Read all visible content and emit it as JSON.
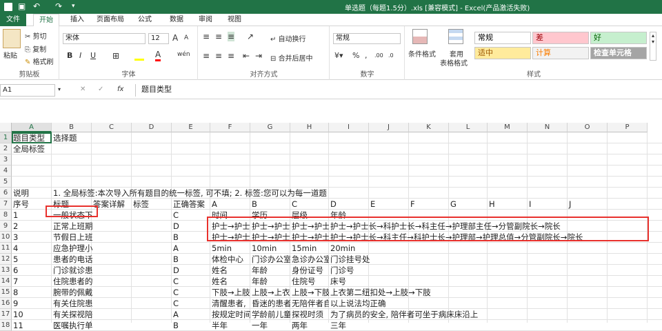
{
  "window": {
    "title": "单选题（每题1.5分）.xls  [兼容模式] - Excel(产品激活失败)"
  },
  "tabs": [
    "文件",
    "开始",
    "插入",
    "页面布局",
    "公式",
    "数据",
    "审阅",
    "视图"
  ],
  "ribbon": {
    "clipboard": {
      "label": "剪贴板",
      "paste": "粘贴",
      "cut": "剪切",
      "copy": "复制",
      "format_painter": "格式刷"
    },
    "font": {
      "label": "字体",
      "name": "宋体",
      "size": "12",
      "bold": "B",
      "italic": "I",
      "underline": "U",
      "grow": "A",
      "shrink": "A",
      "font_color_glyph": "A",
      "wen": "wén"
    },
    "alignment": {
      "label": "对齐方式",
      "wrap": "自动换行",
      "merge": "合并后居中"
    },
    "number": {
      "label": "数字",
      "format": "常规",
      "percent": "%",
      "comma": ","
    },
    "styles_group": {
      "label": "样式",
      "cond_format": "条件格式",
      "table_format_1": "套用",
      "table_format_2": "表格格式",
      "cells": [
        {
          "text": "常规",
          "bg": "#ffffff",
          "fg": "#000000"
        },
        {
          "text": "差",
          "bg": "#ffc7ce",
          "fg": "#9c0006"
        },
        {
          "text": "好",
          "bg": "#c6efce",
          "fg": "#006100"
        },
        {
          "text": "适中",
          "bg": "#ffeb9c",
          "fg": "#9c5700"
        },
        {
          "text": "计算",
          "bg": "#f2f2f2",
          "fg": "#fa7d00"
        },
        {
          "text": "检查单元格",
          "bg": "#a5a5a5",
          "fg": "#ffffff"
        }
      ]
    }
  },
  "formula_bar": {
    "name_box": "A1",
    "fx": "fx",
    "content": "题目类型"
  },
  "columns": [
    "A",
    "B",
    "C",
    "D",
    "E",
    "F",
    "G",
    "H",
    "I",
    "J",
    "K",
    "L",
    "M",
    "N",
    "O",
    "P"
  ],
  "rows": [
    "1",
    "2",
    "3",
    "4",
    "5",
    "6",
    "7",
    "8",
    "9",
    "10",
    "11",
    "12",
    "13",
    "14",
    "15",
    "16",
    "17",
    "18"
  ],
  "cells": {
    "r1": {
      "a": "题目类型",
      "b": "选择题"
    },
    "r2": {
      "a": "全局标签"
    },
    "r6": {
      "a": "说明",
      "b": "1. 全局标签:本次导入所有题目的统一标签, 可不填; 2. 标签:您可以为每一道题"
    },
    "r7": {
      "a": "序号",
      "b": "标题",
      "c": "答案详解",
      "d": "标签",
      "e": "正确答案",
      "f": "A",
      "g": "B",
      "h": "C",
      "i": "D",
      "j": "E",
      "k": "F",
      "l": "G",
      "m": "H",
      "n": "I",
      "o": "J"
    },
    "r8": {
      "a": "1",
      "b": "一般状态下",
      "e": "C",
      "f": "时间",
      "g": "学历",
      "h": "层级",
      "i": "年龄"
    },
    "r9": {
      "a": "2",
      "b": "正常上班期",
      "e": "D",
      "f": "护士→护士",
      "g": "护士→护士",
      "h": "护士→护士",
      "i": "护士→护士长→科护士长→科主任→护理部主任→分管副院长→院长"
    },
    "r10": {
      "a": "3",
      "b": "节假日上班",
      "e": "B",
      "f": "护士→护士",
      "g": "护士→护士",
      "h": "护士→护士",
      "i": "护士→护士长→科主任→科护士长→护理部→护理总值→分管副院长→院长"
    },
    "r11": {
      "a": "4",
      "b": "应急护理小",
      "e": "A",
      "f": "5min",
      "g": "10min",
      "h": "15min",
      "i": "20min"
    },
    "r12": {
      "a": "5",
      "b": "患者的电话",
      "e": "B",
      "f": "体检中心",
      "g": "门诊办公室",
      "h": "急诊办公室",
      "i": "门诊挂号处"
    },
    "r13": {
      "a": "6",
      "b": "门诊就诊患",
      "e": "D",
      "f": "姓名",
      "g": "年龄",
      "h": "身份证号",
      "i": "门诊号"
    },
    "r14": {
      "a": "7",
      "b": "住院患者的",
      "e": "C",
      "f": "姓名",
      "g": "年龄",
      "h": "住院号",
      "i": "床号"
    },
    "r15": {
      "a": "8",
      "b": "腕带的佩戴",
      "e": "C",
      "f": "下肢→上肢",
      "g": "上肢→上衣",
      "h": "上肢→下肢",
      "i": "上衣第二纽扣处→上肢→下肢"
    },
    "r16": {
      "a": "9",
      "b": "有关住院患",
      "e": "C",
      "f": "清醒患者,",
      "g": "昏迷的患者",
      "h": "无陪伴者自",
      "i": "以上说法均正确"
    },
    "r17": {
      "a": "10",
      "b": "有关探视陪",
      "e": "A",
      "f": "按规定时间",
      "g": "学龄前儿童",
      "h": "探视时须",
      "i": "为了病员的安全, 陪伴者可坐于病床床沿上"
    },
    "r18": {
      "a": "11",
      "b": "医嘱执行单",
      "e": "B",
      "f": "半年",
      "g": "一年",
      "h": "两年",
      "i": "三年"
    }
  }
}
